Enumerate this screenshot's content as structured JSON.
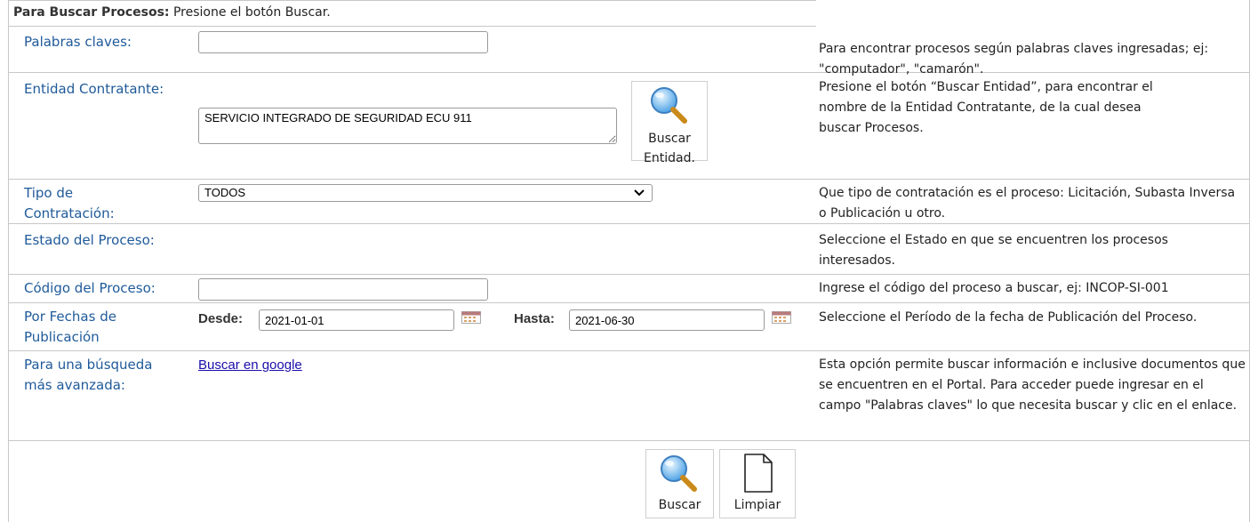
{
  "header": {
    "title_bold": "Para Buscar Procesos:",
    "title_rest": "Presione el botón Buscar."
  },
  "keywords": {
    "label": "Palabras claves:",
    "value": "",
    "help": "Para encontrar procesos según palabras claves ingresadas; ej: \"computador\", \"camarón\"."
  },
  "entity": {
    "label": "Entidad Contratante:",
    "value": "SERVICIO INTEGRADO DE SEGURIDAD ECU 911",
    "button_line1": "Buscar",
    "button_line2": "Entidad.",
    "help": "Presione el botón “Buscar Entidad”, para encontrar el nombre de la Entidad Contratante, de la cual desea buscar Procesos."
  },
  "tipo": {
    "label_line1": "Tipo de",
    "label_line2": "Contratación:",
    "selected": "TODOS",
    "help": "Que tipo de contratación es el proceso: Licitación, Subasta Inversa o Publicación u otro."
  },
  "estado": {
    "label": "Estado del Proceso:",
    "help": "Seleccione el Estado en que se encuentren los procesos interesados."
  },
  "codigo": {
    "label": "Código del Proceso:",
    "value": "",
    "help": "Ingrese el código del proceso a buscar, ej: INCOP-SI-001"
  },
  "fechas": {
    "label_line1": "Por Fechas de",
    "label_line2": "Publicación",
    "desde_label": "Desde:",
    "desde_value": "2021-01-01",
    "hasta_label": "Hasta:",
    "hasta_value": "2021-06-30",
    "help": "Seleccione el Período de la fecha de Publicación del Proceso."
  },
  "avanzada": {
    "label_line1": "Para una búsqueda",
    "label_line2": "más avanzada:",
    "link": "Buscar en google",
    "help": "Esta opción permite buscar información e inclusive documentos que se encuentren en el Portal. Para acceder puede ingresar en el campo \"Palabras claves\" lo que necesita buscar y clic en el enlace."
  },
  "actions": {
    "search_label": "Buscar",
    "clear_label": "Limpiar"
  },
  "icons": {
    "magnifier": "magnifier-icon",
    "calendar": "calendar-icon",
    "blank_page": "blank-page-icon",
    "dropdown": "chevron-down-icon"
  },
  "colors": {
    "label": "#1f5a9a",
    "border": "#c8c8c8",
    "link": "#1a0dab"
  }
}
